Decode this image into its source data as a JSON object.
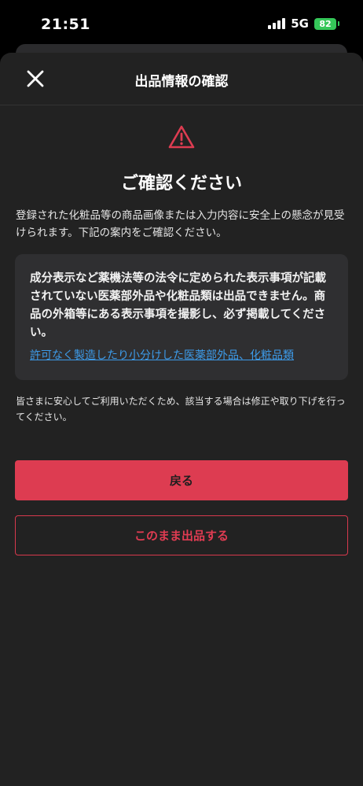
{
  "status_bar": {
    "time": "21:51",
    "network": "5G",
    "battery": "82",
    "icons": [
      "signal-icon",
      "battery-icon"
    ]
  },
  "sheet": {
    "title": "出品情報の確認",
    "close_icon": "close-icon",
    "warning_icon": "warning-triangle-icon",
    "heading": "ご確認ください",
    "intro": "登録された化粧品等の商品画像または入力内容に安全上の懸念が見受けられます。下記の案内をご確認ください。",
    "notice": {
      "text": "成分表示など薬機法等の法令に定められた表示事項が記載されていない医薬部外品や化粧品類は出品できません。商品の外箱等にある表示事項を撮影し、必ず掲載してください。",
      "link": "許可なく製造したり小分けした医薬部外品、化粧品類"
    },
    "footer": "皆さまに安心してご利用いただくため、該当する場合は修正や取り下げを行ってください。",
    "primary_button": "戻る",
    "secondary_button": "このまま出品する"
  },
  "colors": {
    "accent": "#dd3c51",
    "link": "#3d9be9",
    "sheet_background": "#222222",
    "notice_background": "#2f2f31",
    "battery": "#35c759"
  }
}
